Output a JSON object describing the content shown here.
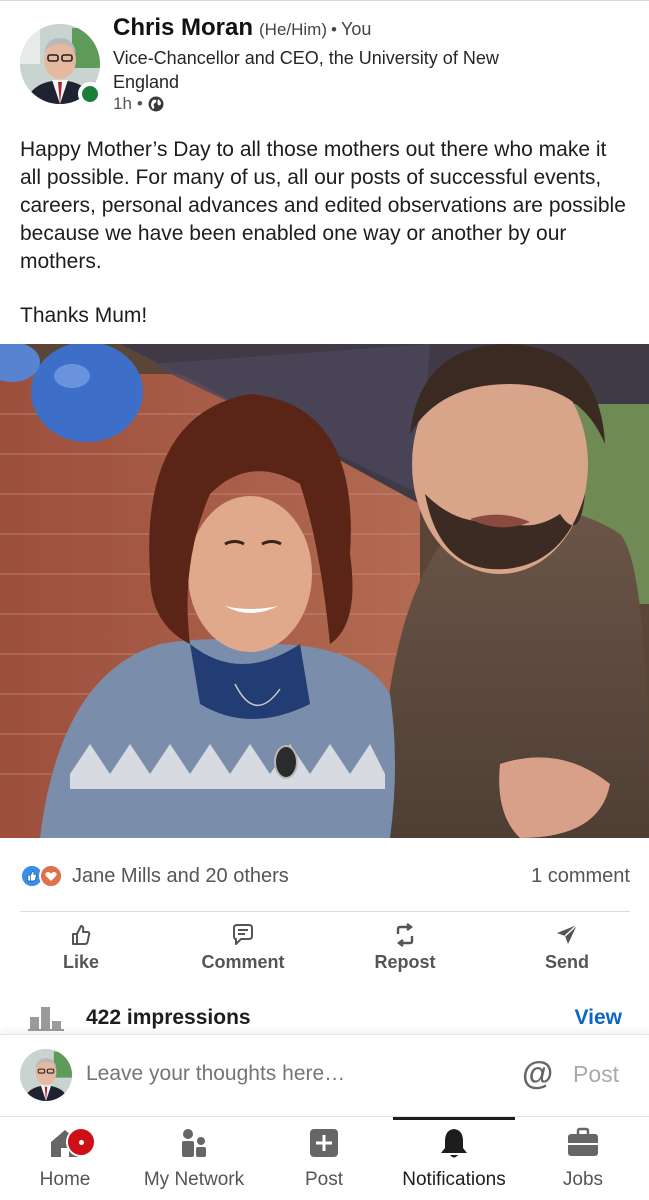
{
  "author": {
    "name": "Chris Moran",
    "pronouns": "(He/Him)",
    "relation": "You",
    "separator": "•",
    "headline": "Vice-Chancellor and CEO, the University of New England",
    "time": "1h",
    "visibility_icon": "globe-icon",
    "online": true
  },
  "post": {
    "paragraph1": "Happy Mother’s Day to all those mothers out there who make it all possible. For many of us, all our posts of successful events, careers, personal advances and edited observations are possible because we have been enabled one way or another by our mothers.",
    "paragraph2": "Thanks Mum!",
    "image_icon": "photo-of-woman-and-man"
  },
  "social": {
    "reactions_text": "Jane Mills and 20 others",
    "reaction_icons": [
      "like-icon",
      "love-icon"
    ],
    "comments_text": "1 comment"
  },
  "actions": [
    {
      "label": "Like",
      "icon": "thumbs-up-icon"
    },
    {
      "label": "Comment",
      "icon": "comment-icon"
    },
    {
      "label": "Repost",
      "icon": "repost-icon"
    },
    {
      "label": "Send",
      "icon": "send-icon"
    }
  ],
  "impressions": {
    "text": "422 impressions",
    "view_label": "View",
    "icon": "bar-chart-icon"
  },
  "composer": {
    "placeholder": "Leave your thoughts here…",
    "mention_symbol": "@",
    "post_label": "Post"
  },
  "bottom_nav": [
    {
      "label": "Home",
      "icon": "home-icon",
      "badge": true
    },
    {
      "label": "My Network",
      "icon": "network-icon"
    },
    {
      "label": "Post",
      "icon": "plus-square-icon"
    },
    {
      "label": "Notifications",
      "icon": "bell-icon",
      "active": true
    },
    {
      "label": "Jobs",
      "icon": "briefcase-icon"
    }
  ],
  "colors": {
    "link_blue": "#0a66c2",
    "online_green": "#1b7f3b",
    "badge_red": "#cc1016",
    "like_blue": "#378fe9",
    "love_red": "#df704d"
  }
}
